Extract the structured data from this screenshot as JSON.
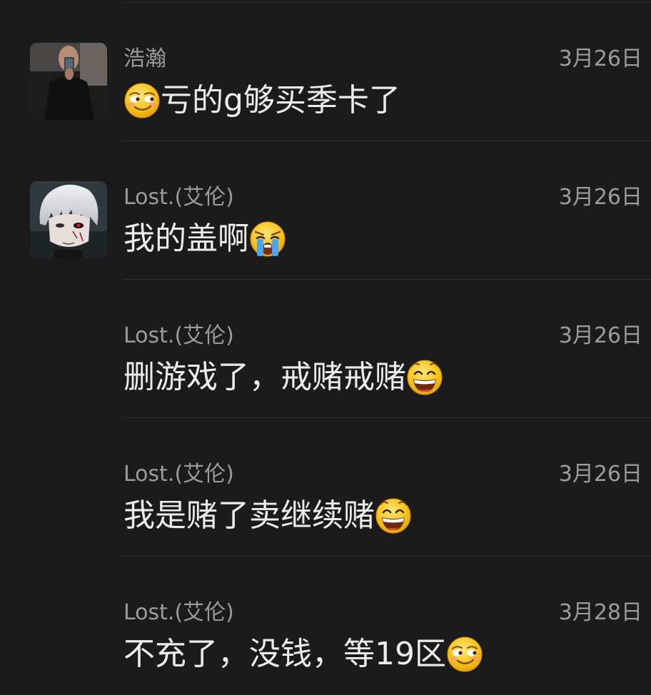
{
  "comments": [
    {
      "username": "浩瀚",
      "date": "3月26日",
      "text_before": "",
      "text_after": "亏的g够买季卡了",
      "emoji": "smirk-emoji"
    },
    {
      "username": "Lost.(艾伦)",
      "date": "3月26日",
      "text_before": "我的盖啊",
      "text_after": "",
      "emoji": "crying-emoji"
    },
    {
      "username": "Lost.(艾伦)",
      "date": "3月26日",
      "text_before": "删游戏了，戒赌戒赌",
      "text_after": "",
      "emoji": "grin-emoji"
    },
    {
      "username": "Lost.(艾伦)",
      "date": "3月26日",
      "text_before": "我是赌了卖继续赌",
      "text_after": "",
      "emoji": "grin-emoji"
    },
    {
      "username": "Lost.(艾伦)",
      "date": "3月28日",
      "text_before": "不充了，没钱，等19区",
      "text_after": "",
      "emoji": "smirk-emoji"
    }
  ],
  "colors": {
    "background": "#1b1b1b",
    "meta_text": "#9c9c9c",
    "message_text": "#ececec",
    "divider": "#2f2f2f",
    "emoji_yellow": "#f7c51b"
  }
}
